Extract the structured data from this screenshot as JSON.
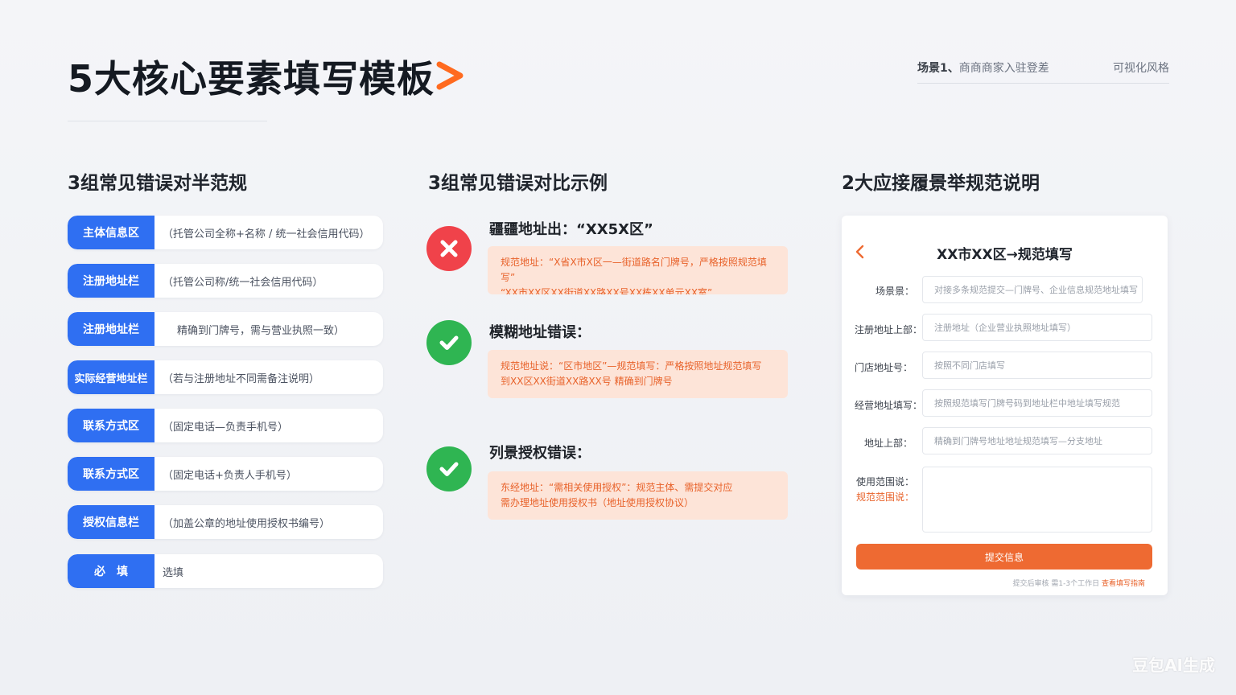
{
  "header": {
    "title": "5大核心要素填写模板",
    "scene_label": "场景1、",
    "scene_text": "商商商家入驻登差",
    "visual_style": "可视化风格"
  },
  "sections": {
    "left_title": "3组常见错误对半范规",
    "middle_title": "3组常见错误对比示例",
    "right_title": "2大应接履景举规范说明"
  },
  "fields": [
    {
      "tag": "主体信息区",
      "desc": "（托管公司全称+名称 / 统一社会信用代码）"
    },
    {
      "tag": "注册地址栏",
      "desc": "（托管公司称/统一社会信用代码）"
    },
    {
      "tag": "注册地址栏",
      "desc": "精确到门牌号，需与营业执照一致）"
    },
    {
      "tag": "实际经营地址栏",
      "desc": "（若与注册地址不同需备注说明）"
    },
    {
      "tag": "联系方式区",
      "desc": "（固定电话—负责手机号）"
    },
    {
      "tag": "联系方式区",
      "desc": "（固定电话+负责人手机号）"
    },
    {
      "tag": "授权信息栏",
      "desc": "（加盖公章的地址使用授权书编号）"
    },
    {
      "tag": "必　填",
      "desc": "选填"
    }
  ],
  "examples": [
    {
      "status": "error",
      "icon": "x-icon",
      "title": "疆疆地址出：“XX5X区”",
      "line1": "规范地址：“X省X市X区一—街道路名门牌号，严格按照规范填写”",
      "line2": "“XX市XX区XX街道XX路XX号XX栋XX单元XX室”"
    },
    {
      "status": "ok",
      "icon": "check-icon",
      "title": "模糊地址错误：",
      "line1": "规范地址说：“区市地区”—规范填写：严格按照地址规范填写",
      "line2": "到XX区XX街道XX路XX号 精确到门牌号"
    },
    {
      "status": "ok",
      "icon": "check-icon",
      "title": "列景授权错误：",
      "line1": "东经地址：“需相关使用授权”：规范主体、需提交对应",
      "line2": "需办理地址使用授权书（地址使用授权协议）"
    }
  ],
  "form": {
    "title": "XX市XX区→规范填写",
    "fields": [
      {
        "label": "场景景：",
        "placeholder": "对接多条规范提交—门牌号、企业信息规范地址填写"
      },
      {
        "label": "注册地址上部：",
        "placeholder": "注册地址（企业营业执照地址填写）"
      },
      {
        "label": "门店地址号：",
        "placeholder": "按照不同门店填写"
      },
      {
        "label": "经营地址填写：",
        "placeholder": "按照规范填写门牌号码到地址栏中地址填写规范"
      },
      {
        "label": "地址上部：",
        "placeholder": "精确到门牌号地址地址规范填写—分支地址"
      }
    ],
    "remark_label_1": "使用范围说：",
    "remark_label_2": "规范范围说：",
    "submit_label": "提交信息",
    "footnote_text": "提交后审核 需1-3个工作日",
    "footnote_link": "查看填写指南"
  },
  "watermark": "豆包AI生成",
  "colors": {
    "brand_blue": "#2f6ff2",
    "accent_orange": "#ee6a32",
    "error_red": "#f0424a",
    "ok_green": "#2fb552",
    "hint_box": "#fde4d8"
  }
}
